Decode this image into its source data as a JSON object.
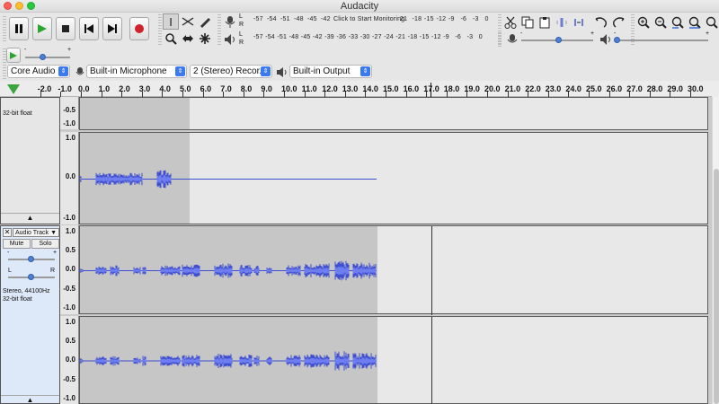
{
  "window": {
    "title": "Audacity"
  },
  "meters": {
    "record_scale": [
      "-57",
      "-54",
      "-51",
      "-48",
      "-45",
      "-42",
      "-3"
    ],
    "monitor_prompt": "Click to Start Monitoring",
    "record_scale_right": [
      "21",
      "-18",
      "-15",
      "-12",
      "-9",
      "-6",
      "-3",
      "0"
    ],
    "playback_scale": [
      "-57",
      "-54",
      "-51",
      "-48",
      "-45",
      "-42",
      "-39",
      "-36",
      "-33",
      "-30",
      "-27",
      "-24",
      "-21",
      "-18",
      "-15",
      "-12",
      "-9",
      "-6",
      "-3",
      "0"
    ],
    "channel_left": "L",
    "channel_right": "R"
  },
  "devices": {
    "host": "Core Audio",
    "recording_device": "Built-in Microphone",
    "channels": "2 (Stereo) Recor...",
    "playback_device": "Built-in Output"
  },
  "ruler": {
    "ticks": [
      "-2.0",
      "-1.0",
      "0.0",
      "1.0",
      "2.0",
      "3.0",
      "4.0",
      "5.0",
      "6.0",
      "7.0",
      "8.0",
      "9.0",
      "10.0",
      "11.0",
      "12.0",
      "13.0",
      "14.0",
      "15.0",
      "16.0",
      "17.0",
      "18.0",
      "19.0",
      "20.0",
      "21.0",
      "22.0",
      "23.0",
      "24.0",
      "25.0",
      "26.0",
      "27.0",
      "28.0",
      "29.0",
      "30.0"
    ]
  },
  "track1": {
    "format": "32-bit float"
  },
  "track2": {
    "name": "Audio Track",
    "mute": "Mute",
    "solo": "Solo",
    "gain_minus": "-",
    "gain_plus": "+",
    "pan_left": "L",
    "pan_right": "R",
    "rate": "Stereo, 44100Hz",
    "format": "32-bit float"
  },
  "vruler_labels": {
    "minus_half": "-0.5",
    "plus_one": "1.0",
    "zero": "0.0",
    "minus_one": "-1.0",
    "plus_half": "0.5"
  },
  "colors": {
    "waveform": "#3f4fcf",
    "waveform_rms": "#6e7ef0",
    "selection": "#c6c6c6",
    "record": "#d0222a",
    "play": "#2aa52e"
  }
}
